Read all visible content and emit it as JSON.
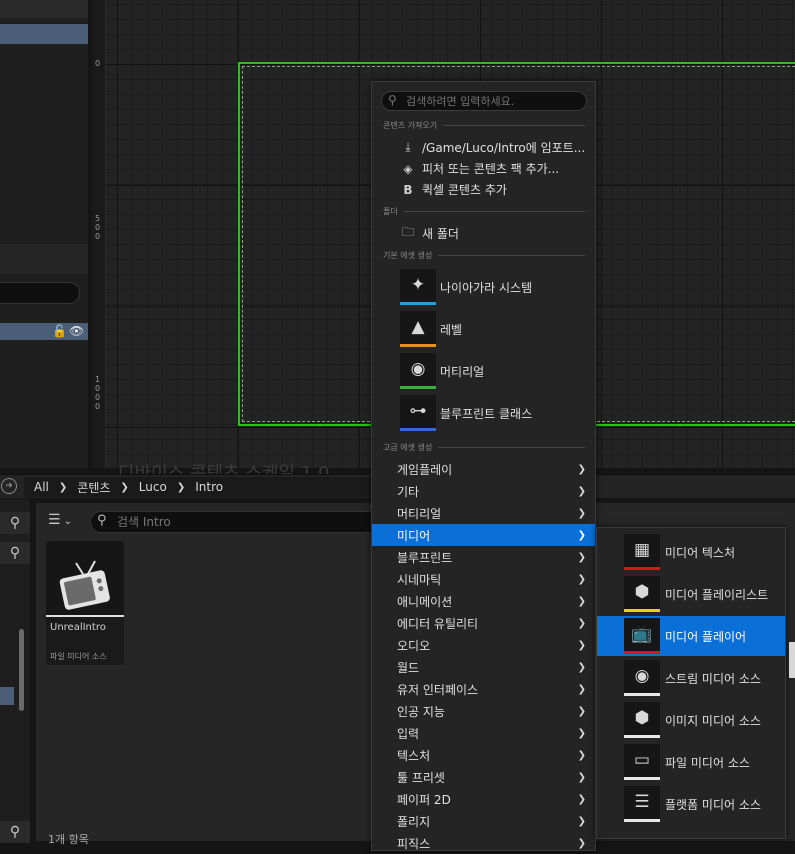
{
  "viewport": {
    "ruler": [
      "0",
      "5\n0\n0",
      "1\n0\n0\n0"
    ],
    "watermark": "디바이스 콘텐츠 스케일 1.0"
  },
  "content_browser": {
    "breadcrumbs": [
      "All",
      "콘텐츠",
      "Luco",
      "Intro"
    ],
    "search_placeholder": "검색 Intro",
    "asset": {
      "name": "UnrealIntro",
      "type": "파일 미디어 소스",
      "icon": "tv-icon"
    },
    "item_count": "1개 항목"
  },
  "context_menu": {
    "search_placeholder": "검색하려면 입력하세요.",
    "sections": {
      "import": "콘텐츠 가져오기",
      "folder": "폴더",
      "basic": "기본 에셋 생성",
      "advanced": "고급 에셋 생성"
    },
    "import_items": [
      {
        "label": "/Game/Luco/Intro에 임포트...",
        "icon": "import-icon"
      },
      {
        "label": "피처 또는 콘텐츠 팩 추가...",
        "icon": "feature-pack-icon"
      },
      {
        "label": "퀵셀 콘텐츠 추가",
        "icon": "quixel-icon"
      }
    ],
    "folder_items": [
      {
        "label": "새 폴더",
        "icon": "new-folder-icon"
      }
    ],
    "basic_items": [
      {
        "label": "나이아가라 시스템",
        "icon": "niagara-icon",
        "color": "#1aa3e8"
      },
      {
        "label": "레벨",
        "icon": "level-icon",
        "color": "#e8901a"
      },
      {
        "label": "머티리얼",
        "icon": "material-icon",
        "color": "#38b23a"
      },
      {
        "label": "블루프린트 클래스",
        "icon": "blueprint-icon",
        "color": "#2e6ad8"
      }
    ],
    "advanced_items": [
      "게임플레이",
      "기타",
      "머티리얼",
      "미디어",
      "블루프린트",
      "시네마틱",
      "애니메이션",
      "에디터 유틸리티",
      "오디오",
      "월드",
      "유저 인터페이스",
      "인공 지능",
      "입력",
      "텍스처",
      "툴 프리셋",
      "페이퍼 2D",
      "폴리지",
      "피직스"
    ],
    "active_item": "미디어"
  },
  "media_submenu": {
    "items": [
      {
        "label": "미디어 텍스처",
        "icon": "media-texture-icon",
        "color": "#d11a1a"
      },
      {
        "label": "미디어 플레이리스트",
        "icon": "media-playlist-icon",
        "color": "#e6d21a"
      },
      {
        "label": "미디어 플레이어",
        "icon": "media-player-icon",
        "color": "#d11a1a"
      },
      {
        "label": "스트림 미디어 소스",
        "icon": "stream-media-source-icon",
        "color": "#e8e8e8"
      },
      {
        "label": "이미지 미디어 소스",
        "icon": "image-media-source-icon",
        "color": "#e8e8e8"
      },
      {
        "label": "파일 미디어 소스",
        "icon": "file-media-source-icon",
        "color": "#e8e8e8"
      },
      {
        "label": "플랫폼 미디어 소스",
        "icon": "platform-media-source-icon",
        "color": "#e8e8e8"
      }
    ],
    "active_item": "미디어 플레이어"
  }
}
